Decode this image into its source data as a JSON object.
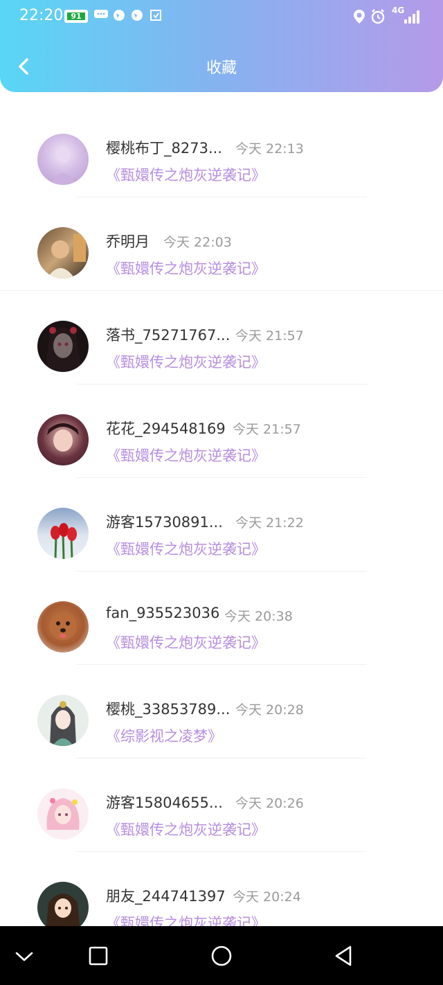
{
  "status_bar": {
    "time": "22:20",
    "battery": "91",
    "network": "4G"
  },
  "header": {
    "title": "收藏"
  },
  "favorites": [
    {
      "name": "樱桃布丁_8273...",
      "time": "今天 22:13",
      "book": "《甄嬛传之炮灰逆袭记》"
    },
    {
      "name": "乔明月",
      "time": "今天 22:03",
      "book": "《甄嬛传之炮灰逆袭记》"
    },
    {
      "name": "落书_75271767...",
      "time": "今天 21:57",
      "book": "《甄嬛传之炮灰逆袭记》"
    },
    {
      "name": "花花_294548169",
      "time": "今天 21:57",
      "book": "《甄嬛传之炮灰逆袭记》"
    },
    {
      "name": "游客15730891...",
      "time": "今天 21:22",
      "book": "《甄嬛传之炮灰逆袭记》"
    },
    {
      "name": "fan_935523036",
      "time": "今天 20:38",
      "book": "《甄嬛传之炮灰逆袭记》"
    },
    {
      "name": "樱桃_33853789...",
      "time": "今天 20:28",
      "book": "《综影视之凌梦》"
    },
    {
      "name": "游客15804655...",
      "time": "今天 20:26",
      "book": "《甄嬛传之炮灰逆袭记》"
    },
    {
      "name": "朋友_244741397",
      "time": "今天 20:24",
      "book": "《甄嬛传之炮灰逆袭记》"
    }
  ],
  "colors": {
    "book_title": "#b68ee0",
    "header_gradient_start": "#59d6f5",
    "header_gradient_end": "#b59ae9"
  }
}
